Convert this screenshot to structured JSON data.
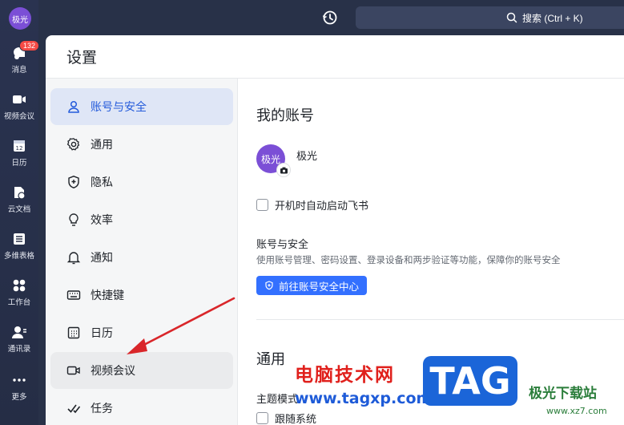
{
  "rail": {
    "avatar_text": "极光",
    "badge_count": "132",
    "items": [
      {
        "label": "消息",
        "icon": "chat-bubble-icon"
      },
      {
        "label": "视频会议",
        "icon": "video-camera-icon"
      },
      {
        "label": "日历",
        "icon": "calendar-icon"
      },
      {
        "label": "云文档",
        "icon": "cloud-doc-icon"
      },
      {
        "label": "多维表格",
        "icon": "base-table-icon"
      },
      {
        "label": "工作台",
        "icon": "workplace-grid-icon"
      },
      {
        "label": "通讯录",
        "icon": "contacts-icon"
      },
      {
        "label": "更多",
        "icon": "more-dots-icon"
      }
    ]
  },
  "topbar": {
    "search_label": "搜索 (Ctrl + K)"
  },
  "settings": {
    "title": "设置",
    "side_items": [
      {
        "label": "账号与安全",
        "icon": "user-icon",
        "state": "active"
      },
      {
        "label": "通用",
        "icon": "gear-icon",
        "state": ""
      },
      {
        "label": "隐私",
        "icon": "shield-icon",
        "state": ""
      },
      {
        "label": "效率",
        "icon": "bulb-icon",
        "state": ""
      },
      {
        "label": "通知",
        "icon": "bell-icon",
        "state": ""
      },
      {
        "label": "快捷键",
        "icon": "keyboard-icon",
        "state": ""
      },
      {
        "label": "日历",
        "icon": "calendar-icon",
        "state": ""
      },
      {
        "label": "视频会议",
        "icon": "video-camera-icon",
        "state": "hover"
      },
      {
        "label": "任务",
        "icon": "task-check-icon",
        "state": ""
      }
    ],
    "main": {
      "my_account_heading": "我的账号",
      "avatar_text": "极光",
      "account_name": "极光",
      "autostart_label": "开机时自动启动飞书",
      "security_title": "账号与安全",
      "security_desc": "使用账号管理、密码设置、登录设备和两步验证等功能，保障你的账号安全",
      "security_button": "前往账号安全中心",
      "general_heading": "通用",
      "theme_label": "主题模式",
      "follow_system_label": "跟随系统"
    }
  },
  "watermark": {
    "site_cn": "电脑技术网",
    "site_url": "www.tagxp.com",
    "tag": "TAG",
    "logo_cn": "极光下载站",
    "logo_url": "www.xz7.com"
  },
  "colors": {
    "accent": "#3370ff",
    "active_text": "#245bdb",
    "badge": "#f54a45",
    "avatar": "#7b4fd6"
  }
}
